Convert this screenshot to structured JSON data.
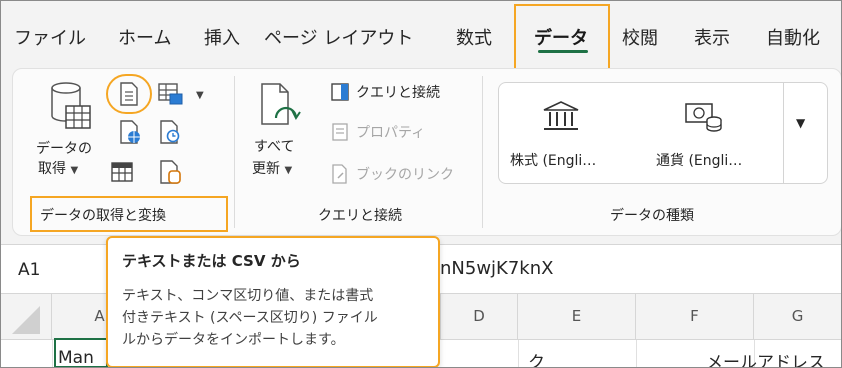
{
  "menu": {
    "tabs": [
      {
        "label": "ファイル"
      },
      {
        "label": "ホーム"
      },
      {
        "label": "挿入"
      },
      {
        "label": "ページ レイアウト"
      },
      {
        "label": "数式"
      },
      {
        "label": "データ"
      },
      {
        "label": "校閲"
      },
      {
        "label": "表示"
      },
      {
        "label": "自動化"
      }
    ],
    "active_tab": "データ"
  },
  "ribbon": {
    "get_data": {
      "get_data_label_line1": "データの",
      "get_data_label_line2": "取得",
      "group_label": "データの取得と変換"
    },
    "queries": {
      "refresh_line1": "すべて",
      "refresh_line2": "更新",
      "queries_connections": "クエリと接続",
      "properties": "プロパティ",
      "edit_links": "ブックのリンク",
      "group_label": "クエリと接続"
    },
    "data_types": {
      "stocks": "株式 (Engli…",
      "currencies": "通貨 (Engli…",
      "group_label": "データの種類"
    }
  },
  "formula_bar": {
    "name_box": "A1",
    "formula_visible": "nN5wjK7knX"
  },
  "grid": {
    "columns": [
      "A",
      "D",
      "E",
      "F",
      "G"
    ],
    "row_partial_text": [
      "Man",
      "ク",
      "メールアドレス"
    ]
  },
  "tooltip": {
    "title": "テキストまたは CSV から",
    "body_lines": [
      "テキスト、コンマ区切り値、または書式",
      "付きテキスト (スペース区切り) ファイル",
      "ルからデータをインポートします。"
    ]
  },
  "colors": {
    "accent_green": "#1e7145",
    "highlight_orange": "#f5a623"
  }
}
